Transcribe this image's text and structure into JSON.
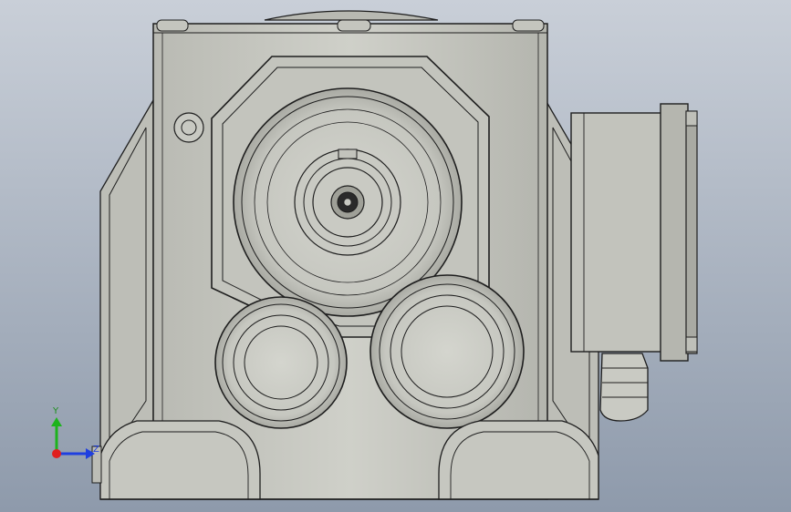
{
  "viewport": {
    "background_top": "#c9cfd8",
    "background_bottom": "#8e9aab",
    "metal_fill": "#c8c9c2",
    "metal_shadow": "#9fa098",
    "edge_color": "#1e1e1e"
  },
  "triad": {
    "y_label": "Y",
    "z_label": "Z",
    "y_color": "#1db31d",
    "z_color": "#1f3fe0",
    "x_color": "#e01f1f"
  }
}
